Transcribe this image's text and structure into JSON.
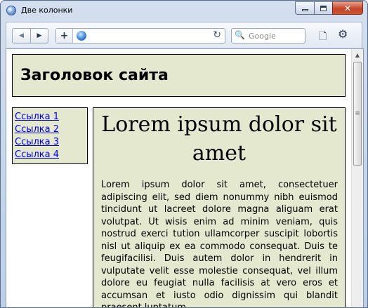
{
  "window": {
    "title": "Две колонки",
    "minimize": "",
    "maximize": "",
    "close": "✕"
  },
  "toolbar": {
    "back_label": "◀",
    "forward_label": "▶",
    "new_tab_label": "+",
    "reload_icon": "↻",
    "search_placeholder": "Google",
    "search_icon": "🔍",
    "page_icon": "🗋",
    "gear_icon": "⚙"
  },
  "page": {
    "site_title": "Заголовок сайта",
    "links": [
      "Ссылка 1",
      "Ссылка 2",
      "Ссылка 3",
      "Ссылка 4"
    ],
    "content_title": "Lorem ipsum dolor sit amet",
    "content_text": "Lorem ipsum dolor sit amet, consectetuer adipiscing elit, sed diem nonummy nibh euismod tincidunt ut lacreet dolore magna aliguam erat volutpat. Ut wisis enim ad minim veniam, quis nostrud exerci tution ullamcorper suscipit lobortis nisl ut aliquip ex ea commodo consequat. Duis te feugifacilisi. Duis autem dolor in hendrerit in vulputate velit esse molestie consequat, vel illum dolore eu feugiat nulla facilisis at vero eros et accumsan et iusto odio dignissim qui blandit praesent luptatum"
  },
  "colors": {
    "page_bg": "#ffffff",
    "block_bg": "#e4e8cf",
    "border": "#000000",
    "link": "#0000ee"
  }
}
